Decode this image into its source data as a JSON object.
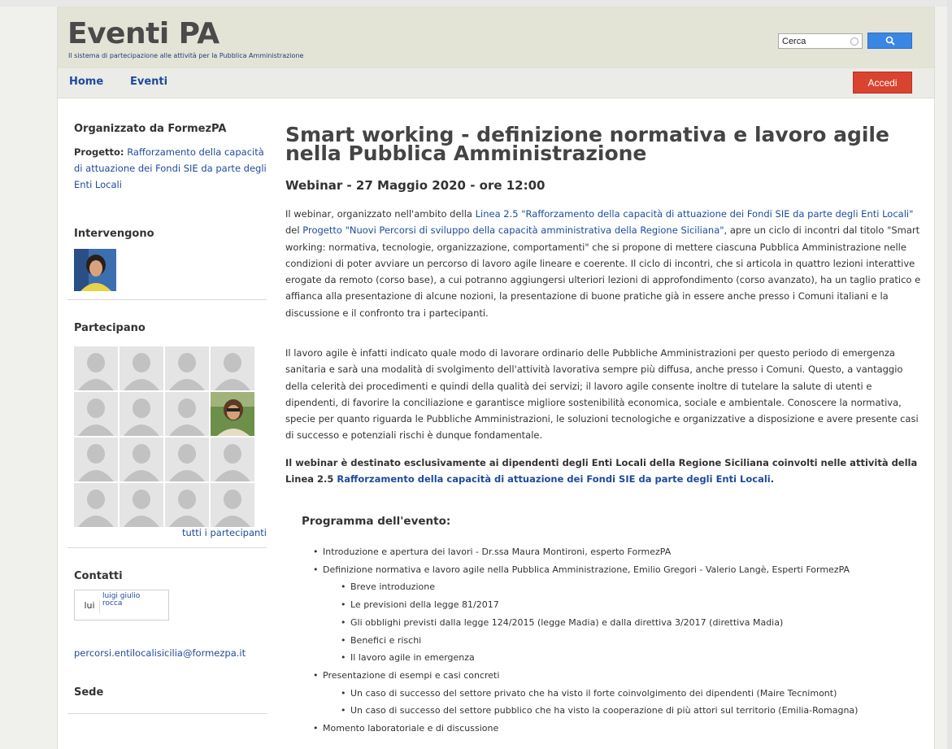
{
  "header": {
    "title": "Eventi PA",
    "subtitle": "Il sistema di partecipazione alle attività per la Pubblica Amministrazione",
    "search_value": "Cerca",
    "login_label": "Accedi"
  },
  "nav": {
    "items": [
      "Home",
      "Eventi"
    ]
  },
  "sidebar": {
    "organizer_heading": "Organizzato da FormezPA",
    "project_label": "Progetto:",
    "project_link": "Rafforzamento della capacità di attuazione dei Fondi SIE da parte degli Enti Locali",
    "speakers_heading": "Intervengono",
    "participants_heading": "Partecipano",
    "all_participants_link": "tutti i partecipanti",
    "contacts_heading": "Contatti",
    "contact_role": "lui",
    "contact_name": "luigi giulio rocca",
    "contact_email": "percorsi.entilocalisicilia@formezpa.it",
    "venue_heading": "Sede"
  },
  "main": {
    "title": "Smart working - definizione normativa e lavoro agile nella Pubblica Amministrazione",
    "subtitle": "Webinar - 27 Maggio 2020 - ore 12:00",
    "p1_a": "Il webinar, organizzato nell'ambito della ",
    "p1_link1": "Linea 2.5 \"Rafforzamento della capacità di attuazione dei Fondi SIE da parte degli Enti Locali\"",
    "p1_b": " del ",
    "p1_link2": "Progetto \"Nuovi Percorsi di sviluppo della capacità amministrativa della Regione Siciliana\"",
    "p1_c": ", apre un ciclo di incontri dal titolo \"Smart working: normativa, tecnologie, organizzazione, comportamenti\" che si propone di mettere ciascuna Pubblica Amministrazione nelle condizioni di poter avviare un percorso di lavoro agile lineare e coerente. Il ciclo di incontri, che si articola in quattro lezioni interattive erogate da remoto (corso base), a cui potranno aggiungersi ulteriori lezioni di approfondimento (corso avanzato), ha un taglio pratico e affianca alla presentazione di alcune nozioni, la presentazione di buone pratiche già in essere anche presso i Comuni italiani e la discussione e il confronto tra i partecipanti.",
    "p2": "Il lavoro agile è infatti indicato quale modo di lavorare ordinario delle Pubbliche Amministrazioni per questo periodo di emergenza sanitaria e sarà una modalità di svolgimento dell'attività lavorativa sempre più diffusa, anche presso i Comuni. Questo, a vantaggio della celerità dei procedimenti e quindi della qualità dei servizi; il lavoro agile consente inoltre di tutelare la salute di utenti e dipendenti, di favorire la conciliazione e garantisce migliore sostenibilità economica, sociale e ambientale. Conoscere la normativa, specie per quanto riguarda le Pubbliche Amministrazioni, le soluzioni tecnologiche e organizzative a disposizione e avere presente casi di successo e potenziali rischi è dunque fondamentale.",
    "p3_a": "Il webinar è destinato esclusivamente ai dipendenti degli Enti Locali della Regione Siciliana coinvolti nelle attività della Linea 2.5 ",
    "p3_link": "Rafforzamento della capacità di attuazione dei Fondi SIE da parte degli Enti Locali",
    "p3_b": ".",
    "program_heading": "Programma dell'evento:",
    "program": [
      {
        "level": 1,
        "text": "Introduzione e apertura dei lavori - Dr.ssa Maura Montironi,  esperto FormezPA"
      },
      {
        "level": 1,
        "text": "Definizione normativa e lavoro agile nella Pubblica Amministrazione, Emilio Gregori - Valerio Langè, Esperti FormezPA"
      },
      {
        "level": 2,
        "text": "Breve introduzione"
      },
      {
        "level": 2,
        "text": "Le previsioni della legge 81/2017"
      },
      {
        "level": 2,
        "text": "Gli obblighi previsti dalla legge 124/2015 (legge Madia) e dalla direttiva 3/2017 (direttiva Madia)"
      },
      {
        "level": 2,
        "text": "Benefici e rischi"
      },
      {
        "level": 2,
        "text": "Il lavoro agile in emergenza"
      },
      {
        "level": 1,
        "text": "Presentazione di esempi e casi concreti"
      },
      {
        "level": 2,
        "text": "Un caso di successo del settore privato che ha visto il forte coinvolgimento dei dipendenti (Maire Tecnimont)"
      },
      {
        "level": 2,
        "text": "Un caso di successo del settore pubblico che ha visto la cooperazione di più attori sul territorio (Emilia-Romagna)"
      },
      {
        "level": 1,
        "text": "Momento laboratoriale e di discussione"
      }
    ]
  },
  "colors": {
    "link": "#1f4a9a",
    "login": "#d9432f",
    "search": "#3a86e4",
    "header_bg": "#e3e3d6"
  }
}
